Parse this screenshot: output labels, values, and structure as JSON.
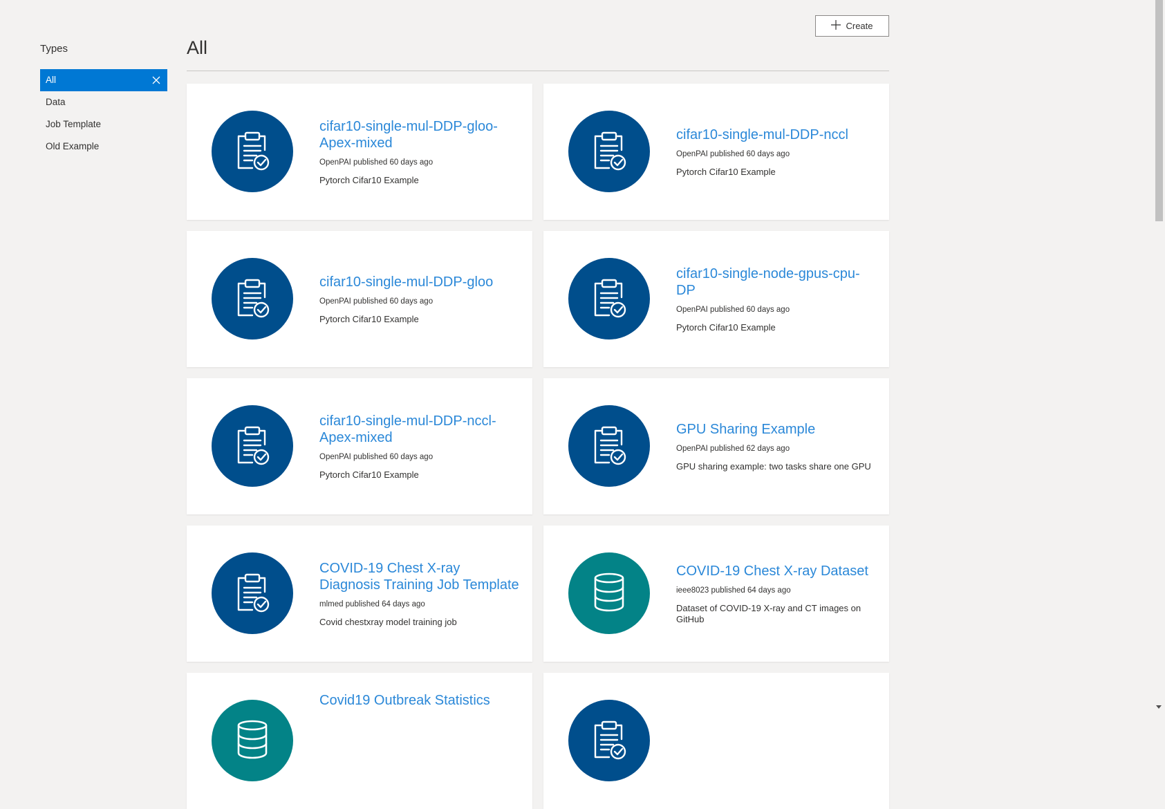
{
  "sidebar": {
    "title": "Types",
    "items": [
      {
        "label": "All"
      },
      {
        "label": "Data"
      },
      {
        "label": "Job Template"
      },
      {
        "label": "Old Example"
      }
    ]
  },
  "header": {
    "title": "All",
    "create_label": "Create"
  },
  "colors": {
    "accent": "#0078d4",
    "job_icon_bg": "#004e8c",
    "data_icon_bg": "#038387",
    "title_link": "#2b88d8"
  },
  "cards": [
    {
      "title": "cifar10-single-mul-DDP-gloo-Apex-mixed",
      "meta": "OpenPAI published 60 days ago",
      "desc": "Pytorch Cifar10 Example",
      "icon": "clipboard-check-icon"
    },
    {
      "title": "cifar10-single-mul-DDP-nccl",
      "meta": "OpenPAI published 60 days ago",
      "desc": "Pytorch Cifar10 Example",
      "icon": "clipboard-check-icon"
    },
    {
      "title": "cifar10-single-mul-DDP-gloo",
      "meta": "OpenPAI published 60 days ago",
      "desc": "Pytorch Cifar10 Example",
      "icon": "clipboard-check-icon"
    },
    {
      "title": "cifar10-single-node-gpus-cpu-DP",
      "meta": "OpenPAI published 60 days ago",
      "desc": "Pytorch Cifar10 Example",
      "icon": "clipboard-check-icon"
    },
    {
      "title": "cifar10-single-mul-DDP-nccl-Apex-mixed",
      "meta": "OpenPAI published 60 days ago",
      "desc": "Pytorch Cifar10 Example",
      "icon": "clipboard-check-icon"
    },
    {
      "title": "GPU Sharing Example",
      "meta": "OpenPAI published 62 days ago",
      "desc": "GPU sharing example: two tasks share one GPU",
      "icon": "clipboard-check-icon"
    },
    {
      "title": "COVID-19 Chest X-ray Diagnosis Training Job Template",
      "meta": "mlmed published 64 days ago",
      "desc": "Covid chestxray model training job",
      "icon": "clipboard-check-icon"
    },
    {
      "title": "COVID-19 Chest X-ray Dataset",
      "meta": "ieee8023 published 64 days ago",
      "desc": "Dataset of COVID-19 X-ray and CT images on GitHub",
      "icon": "database-icon"
    },
    {
      "title": "Covid19 Outbreak Statistics",
      "meta": "",
      "desc": "",
      "icon": "database-icon"
    },
    {
      "title": "",
      "meta": "",
      "desc": "",
      "icon": "clipboard-check-icon"
    }
  ]
}
